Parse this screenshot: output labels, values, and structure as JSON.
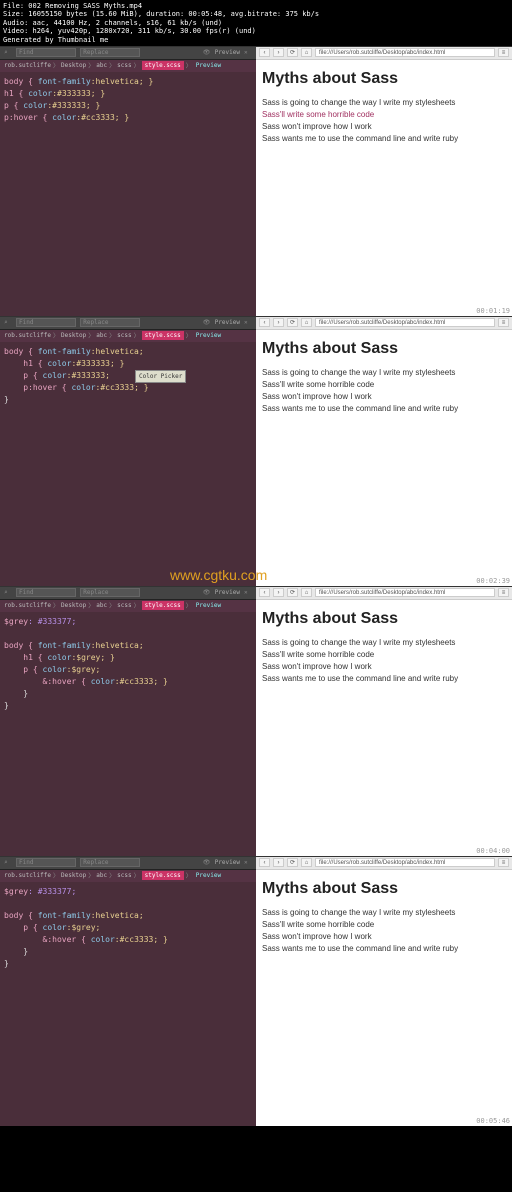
{
  "ffprobe": {
    "l1": "File: 002 Removing SASS Myths.mp4",
    "l2": "Size: 16055150 bytes (15.60 MiB), duration: 00:05:48, avg.bitrate: 375 kb/s",
    "l3": "Audio: aac, 44100 Hz, 2 channels, s16, 61 kb/s (und)",
    "l4": "Video: h264, yuv420p, 1280x720, 311 kb/s, 30.00 fps(r) (und)",
    "l5": "Generated by Thumbnail me"
  },
  "editor_top": {
    "find": "Find",
    "replace": "Replace",
    "preview": "Preview"
  },
  "breadcrumb": {
    "user": "rob.sutcliffe",
    "p1": "Desktop",
    "p2": "abc",
    "p3": "scss",
    "file": "style.scss",
    "sep": "〉"
  },
  "url": "file:///Users/rob.sutcliffe/Desktop/abc/index.html",
  "page": {
    "title": "Myths about Sass",
    "p1": "Sass is going to change the way I write my stylesheets",
    "p2": "Sass'll write some horrible code",
    "p3": "Sass won't improve how I work",
    "p4": "Sass wants me to use the command line and write ruby"
  },
  "watermark": "www.cgtku.com",
  "timestamps": {
    "t1": "00:01:19",
    "t2": "00:02:39",
    "t3": "00:04:00",
    "t4": "00:05:46"
  },
  "tooltip": "Color Picker",
  "code1": {
    "l1a": "body { ",
    "l1b": "font-family",
    "l1c": ":helvetica; }",
    "l2a": "h1 { ",
    "l2b": "color",
    "l2c": ":#333333; }",
    "l3a": "p { ",
    "l3b": "color",
    "l3c": ":#333333; }",
    "l4a": "p:hover { ",
    "l4b": "color",
    "l4c": ":#cc3333; }"
  },
  "code2": {
    "l1a": "body { ",
    "l1b": "font-family",
    "l1c": ":helvetica;",
    "l2a": "    h1 { ",
    "l2b": "color",
    "l2c": ":#333333; }",
    "l3a": "    p { ",
    "l3b": "color",
    "l3c": ":#333333;",
    "l4a": "    p:hover { ",
    "l4b": "color",
    "l4c": ":#cc3333; }",
    "l5": "}"
  },
  "code3": {
    "l0a": "$grey",
    "l0b": ": #333377;",
    "l1a": "body { ",
    "l1b": "font-family",
    "l1c": ":helvetica;",
    "l2a": "    h1 { ",
    "l2b": "color",
    "l2c": ":$grey; }",
    "l3a": "    p { ",
    "l3b": "color",
    "l3c": ":$grey;",
    "l4a": "        &:hover { ",
    "l4b": "color",
    "l4c": ":#cc3333; }",
    "l5": "    }",
    "l6": "}"
  },
  "code4": {
    "l0a": "$grey",
    "l0b": ": #333377;",
    "l1a": "body { ",
    "l1b": "font-family",
    "l1c": ":helvetica;",
    "l2a": "    p { ",
    "l2b": "color",
    "l2c": ":$grey;",
    "l3a": "        &:hover { ",
    "l3b": "color",
    "l3c": ":#cc3333; }",
    "l4": "    }",
    "l5": "}"
  }
}
